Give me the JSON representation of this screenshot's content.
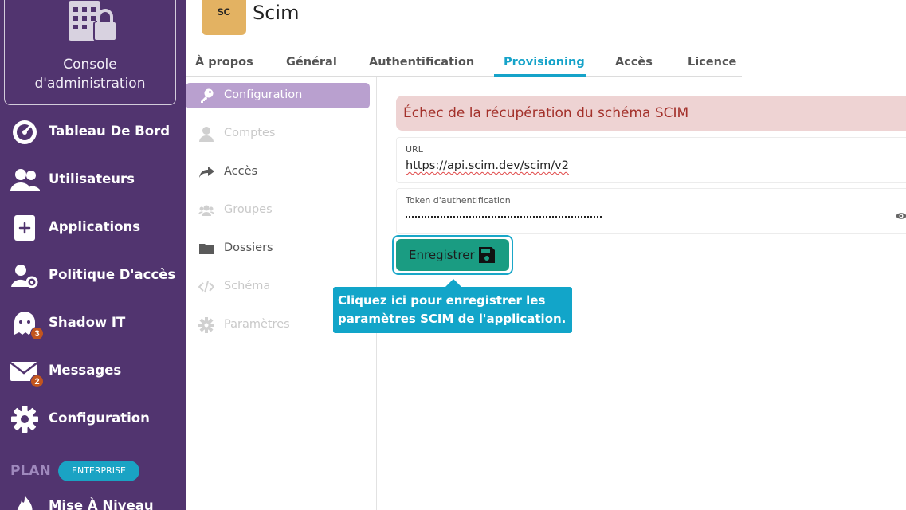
{
  "sidebar": {
    "console_label": "Console\nd'administration",
    "items": [
      {
        "label": "Tableau De Bord",
        "icon": "dashboard-gauge-icon"
      },
      {
        "label": "Utilisateurs",
        "icon": "users-icon"
      },
      {
        "label": "Applications",
        "icon": "plus-square-icon"
      },
      {
        "label": "Politique D'accès",
        "icon": "user-gear-icon"
      },
      {
        "label": "Shadow IT",
        "icon": "ghost-icon",
        "badge": "3"
      },
      {
        "label": "Messages",
        "icon": "envelope-icon",
        "badge": "2"
      },
      {
        "label": "Configuration",
        "icon": "gear-icon"
      },
      {
        "label": "Mise À Niveau",
        "icon": "fire-icon"
      }
    ],
    "plan_label": "PLAN",
    "plan_badge": "ENTERPRISE"
  },
  "app": {
    "logo_text": "SC",
    "title": "Scim"
  },
  "tabs": [
    {
      "label": "À propos"
    },
    {
      "label": "Général"
    },
    {
      "label": "Authentification"
    },
    {
      "label": "Provisioning",
      "active": true
    },
    {
      "label": "Accès"
    },
    {
      "label": "Licence"
    }
  ],
  "subnav": [
    {
      "label": "Configuration",
      "icon": "key-icon",
      "state": "active"
    },
    {
      "label": "Comptes",
      "icon": "user-icon",
      "state": "disabled"
    },
    {
      "label": "Accès",
      "icon": "share-arrow-icon",
      "state": "normal"
    },
    {
      "label": "Groupes",
      "icon": "group-icon",
      "state": "disabled"
    },
    {
      "label": "Dossiers",
      "icon": "folder-icon",
      "state": "normal"
    },
    {
      "label": "Schéma",
      "icon": "code-icon",
      "state": "disabled"
    },
    {
      "label": "Paramètres",
      "icon": "gear-icon",
      "state": "disabled"
    }
  ],
  "main": {
    "error_message": "Échec de la récupération du schéma SCIM",
    "url_label": "URL",
    "url_value": "https://api.scim.dev/scim/v2",
    "token_label": "Token d'authentification",
    "save_label": "Enregistrer"
  },
  "tooltip": {
    "text": "Cliquez ici pour enregistrer les\nparamètres SCIM de l'application."
  },
  "colors": {
    "sidebar": "#51346f",
    "accent": "#16a3c9",
    "save": "#1a9c82",
    "error_bg": "#eed3d3",
    "error_text": "#a3302a"
  }
}
